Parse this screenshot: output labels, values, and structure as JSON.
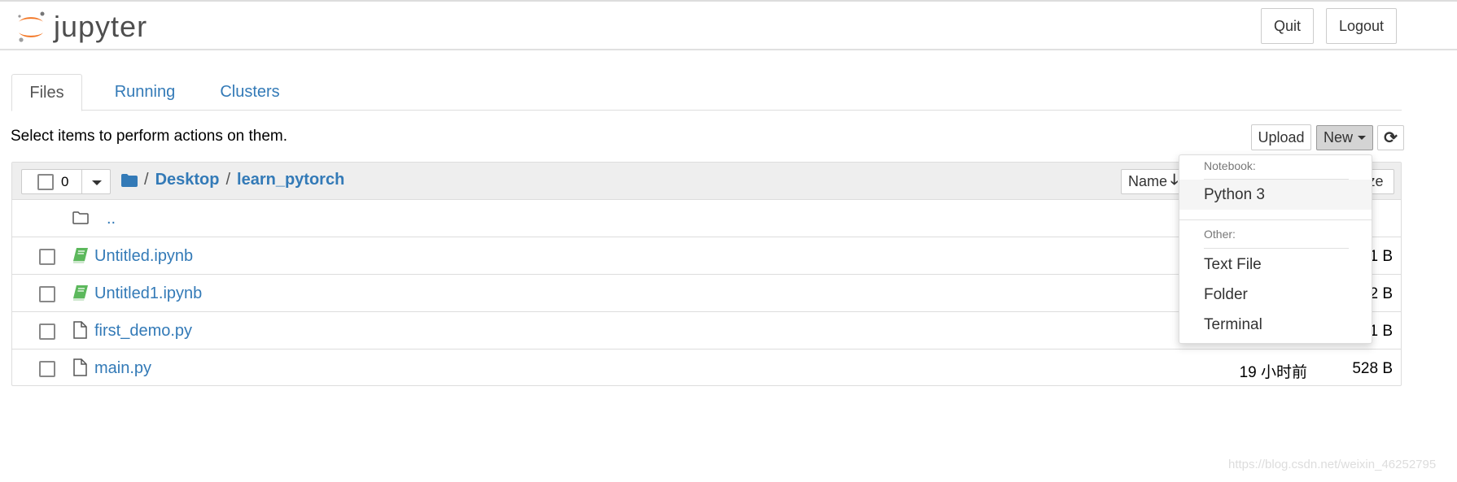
{
  "header": {
    "logo_text": "jupyter",
    "quit": "Quit",
    "logout": "Logout"
  },
  "tabs": [
    {
      "label": "Files",
      "active": true
    },
    {
      "label": "Running"
    },
    {
      "label": "Clusters"
    }
  ],
  "hint": "Select items to perform actions on them.",
  "toolbar": {
    "upload": "Upload",
    "new": "New",
    "refresh_icon": "refresh-icon"
  },
  "list": {
    "selected_count": "0",
    "breadcrumb": [
      "Desktop",
      "learn_pytorch"
    ],
    "sort_name": "Name",
    "sort_size": "Size",
    "parent": "..",
    "rows": [
      {
        "name": "Untitled.ipynb",
        "type": "notebook",
        "modified": "",
        "size": "1 B"
      },
      {
        "name": "Untitled1.ipynb",
        "type": "notebook",
        "modified": "",
        "size": "2 B"
      },
      {
        "name": "first_demo.py",
        "type": "file",
        "modified": "",
        "size": "1 B"
      },
      {
        "name": "main.py",
        "type": "file",
        "modified": "19 小时前",
        "size": "528 B"
      }
    ]
  },
  "new_menu": {
    "notebook_header": "Notebook:",
    "python3": "Python 3",
    "other_header": "Other:",
    "text_file": "Text File",
    "folder": "Folder",
    "terminal": "Terminal"
  },
  "watermark": "https://blog.csdn.net/weixin_46252795",
  "colors": {
    "link": "#337ab7",
    "notebook_icon": "#5cb85c",
    "logo_orange": "#f37726"
  }
}
